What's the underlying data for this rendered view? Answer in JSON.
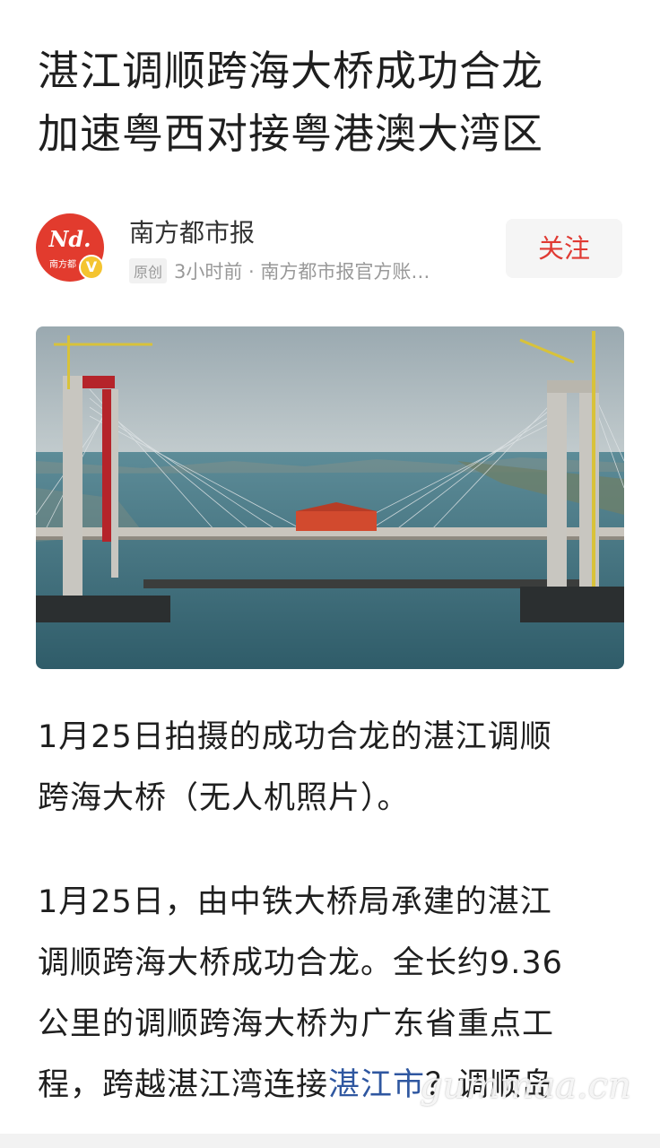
{
  "article": {
    "title_line1": "湛江调顺跨海大桥成功合龙",
    "title_line2": "加速粤西对接粤港澳大湾区"
  },
  "author": {
    "avatar_logo": "Nd.",
    "avatar_sub": "南方都",
    "verified_badge": "V",
    "name": "南方都市报",
    "original_tag": "原创",
    "meta": "3小时前 · 南方都市报官方账…",
    "follow_label": "关注"
  },
  "photo": {
    "icon": "bridge-photo"
  },
  "body": {
    "caption_line1": "1月25日拍摄的成功合龙的湛江调顺",
    "caption_line2": "跨海大桥（无人机照片）。",
    "para_line1": "1月25日，由中铁大桥局承建的湛江",
    "para_line2": "调顺跨海大桥成功合龙。全长约9.36",
    "para_line3": "公里的调顺跨海大桥为广东省重点工",
    "para_line4_a": "程，跨越湛江湾连接",
    "para_line4_link": "湛江市",
    "para_line4_b": "？调顺岛"
  },
  "watermark": "gummaa.cn",
  "colors": {
    "brand_red": "#e03a33",
    "link_blue": "#2f57a0",
    "badge_yellow": "#f4c430"
  }
}
